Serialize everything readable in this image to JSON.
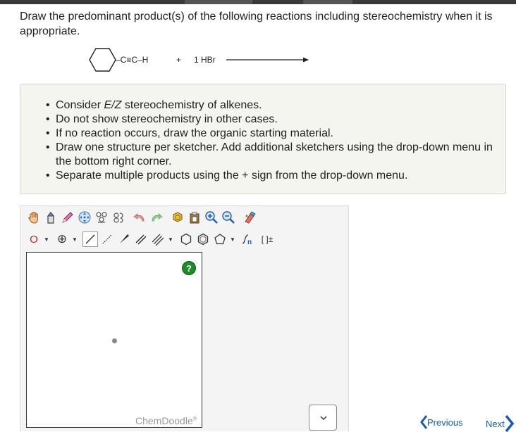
{
  "question": {
    "text": "Draw the predominant product(s) of the following reactions including stereochemistry when it is appropriate."
  },
  "reaction": {
    "substituent": "–C≡C–H",
    "plus": "+",
    "reagent": "1 HBr"
  },
  "instructions": {
    "items": [
      {
        "before": "Consider ",
        "em": "E/Z",
        "after": " stereochemistry of alkenes."
      },
      {
        "before": "Do not show stereochemistry in other cases.",
        "em": "",
        "after": ""
      },
      {
        "before": "If no reaction occurs, draw the organic starting material.",
        "em": "",
        "after": ""
      },
      {
        "before": "Draw one structure per sketcher. Add additional sketchers using the drop-down menu in the bottom right corner.",
        "em": "",
        "after": ""
      },
      {
        "before": "Separate multiple products using the + sign from the drop-down menu.",
        "em": "",
        "after": ""
      }
    ]
  },
  "sketcher": {
    "atom_label": "O",
    "charge_symbol": "⊕",
    "bracket_label": "[ ]±",
    "help_label": "?",
    "brand": "ChemDoodle",
    "brand_mark": "®"
  },
  "nav": {
    "previous": "Previous",
    "next": "Next"
  },
  "colors": {
    "link": "#1a5ca8",
    "help": "#1e8a2a",
    "atom_red": "#cc2222"
  },
  "icons": [
    "hand-icon",
    "eraser-icon",
    "pencil-icon",
    "center-icon",
    "copy-atoms-icon",
    "lasso-icon",
    "undo-icon",
    "redo-icon",
    "template-icon",
    "clear-icon",
    "zoom-in-icon",
    "zoom-out-icon",
    "clean-icon"
  ]
}
